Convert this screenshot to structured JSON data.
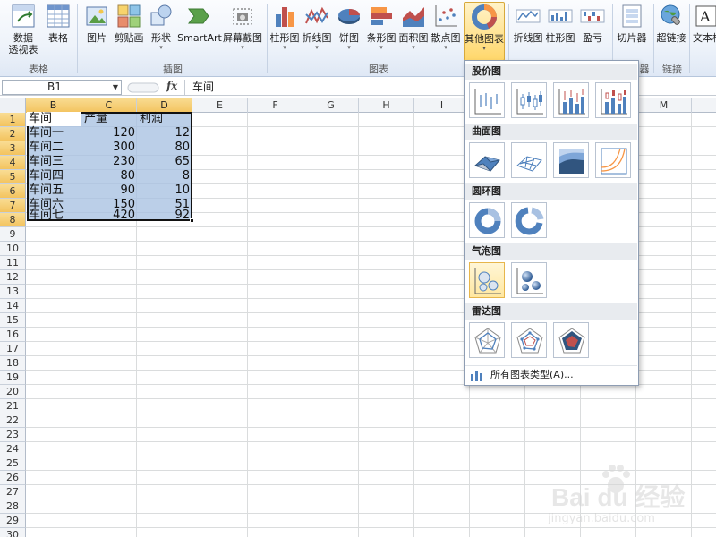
{
  "ribbon": {
    "buttons": {
      "pivot_line1": "数据",
      "pivot_line2": "透视表",
      "table": "表格",
      "picture": "图片",
      "clipart": "剪贴画",
      "shapes": "形状",
      "smartart": "SmartArt",
      "screenshot": "屏幕截图",
      "column": "柱形图",
      "line": "折线图",
      "pie": "饼图",
      "bar": "条形图",
      "area": "面积图",
      "scatter": "散点图",
      "other": "其他图表",
      "spark_line": "折线图",
      "spark_column": "柱形图",
      "spark_winloss": "盈亏",
      "slicer": "切片器",
      "hyperlink": "超链接",
      "textbox": "文本框"
    },
    "groups": {
      "tables": "表格",
      "illustrations": "插图",
      "charts": "图表",
      "links": "链接",
      "filter_partial": "器"
    }
  },
  "formula_bar": {
    "name_box": "B1",
    "fx": "fx",
    "content": "车间"
  },
  "sheet": {
    "columns": [
      "B",
      "C",
      "D",
      "E",
      "F",
      "G",
      "H",
      "I",
      "M"
    ],
    "rows": [
      "1",
      "2",
      "3",
      "4",
      "5",
      "6",
      "7",
      "8",
      "9",
      "10",
      "11",
      "12",
      "13",
      "14",
      "15",
      "16",
      "17",
      "18",
      "19",
      "20",
      "21",
      "22",
      "23",
      "24",
      "25",
      "26",
      "27",
      "28",
      "29",
      "30"
    ],
    "headers": [
      "车间",
      "产量",
      "利润"
    ],
    "data": [
      [
        "车间一",
        "120",
        "12"
      ],
      [
        "车间二",
        "300",
        "80"
      ],
      [
        "车间三",
        "230",
        "65"
      ],
      [
        "车间四",
        "80",
        "8"
      ],
      [
        "车间五",
        "90",
        "10"
      ],
      [
        "车间六",
        "150",
        "51"
      ],
      [
        "车间七",
        "420",
        "92"
      ]
    ]
  },
  "dropdown": {
    "sections": [
      "股价图",
      "曲面图",
      "圆环图",
      "气泡图",
      "雷达图"
    ],
    "all_types": "所有图表类型(A)..."
  },
  "colors": {
    "selection_fill": "#a8c1e2",
    "header_highlight": "#f3c35e",
    "active_button": "#ffd76b"
  },
  "watermark": {
    "brand": "Bai du 经验",
    "url": "jingyan.baidu.com"
  }
}
